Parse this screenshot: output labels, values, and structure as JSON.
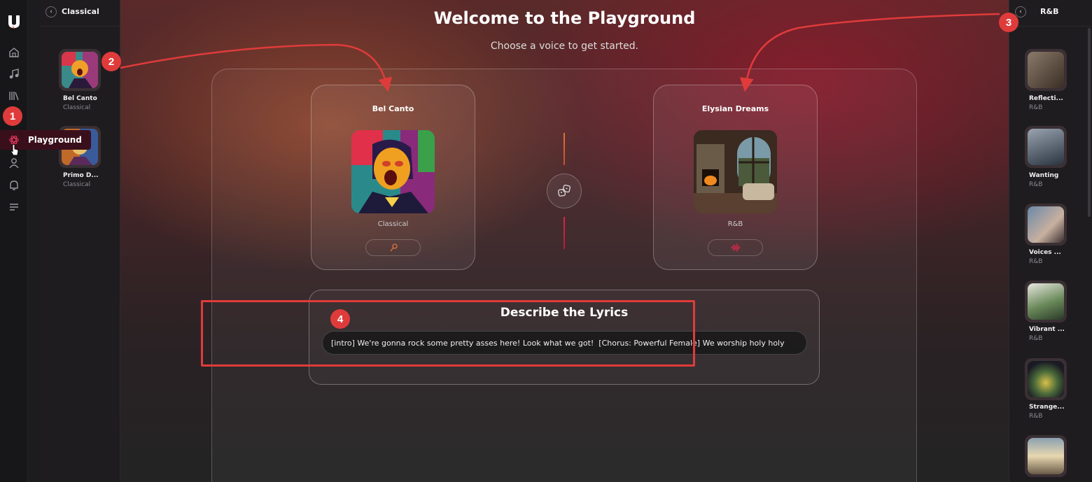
{
  "rail": {
    "logo": "brand-logo",
    "items": [
      {
        "name": "home-icon"
      },
      {
        "name": "music-note-icon"
      },
      {
        "name": "library-icon"
      },
      {
        "name": "playground-icon"
      },
      {
        "name": "profile-icon"
      },
      {
        "name": "bell-icon"
      },
      {
        "name": "menu-icon"
      }
    ],
    "tooltip": "Playground"
  },
  "left_panel": {
    "title": "Classical",
    "items": [
      {
        "title": "Bel Canto",
        "subtitle": "Classical"
      },
      {
        "title": "Primo D...",
        "subtitle": "Classical"
      }
    ]
  },
  "main": {
    "title": "Welcome to the Playground",
    "subtitle": "Choose a voice to get started.",
    "voice_left": {
      "name": "Bel Canto",
      "genre": "Classical"
    },
    "voice_right": {
      "name": "Elysian Dreams",
      "genre": "R&B"
    },
    "lyrics": {
      "title": "Describe the Lyrics",
      "value": "[intro] We're gonna rock some pretty asses here! Look what we got!  [Chorus: Powerful Female] We worship holy holy"
    }
  },
  "right_panel": {
    "title": "R&B",
    "items": [
      {
        "title": "Reflecti...",
        "subtitle": "R&B"
      },
      {
        "title": "Wanting",
        "subtitle": "R&B"
      },
      {
        "title": "Voices ...",
        "subtitle": "R&B"
      },
      {
        "title": "Vibrant ...",
        "subtitle": "R&B"
      },
      {
        "title": "Strange...",
        "subtitle": "R&B"
      }
    ]
  },
  "callouts": [
    "1",
    "2",
    "3",
    "4"
  ],
  "colors": {
    "accent_orange": "#e0743a",
    "accent_red": "#d8284a",
    "callout_red": "#e03b3b"
  }
}
